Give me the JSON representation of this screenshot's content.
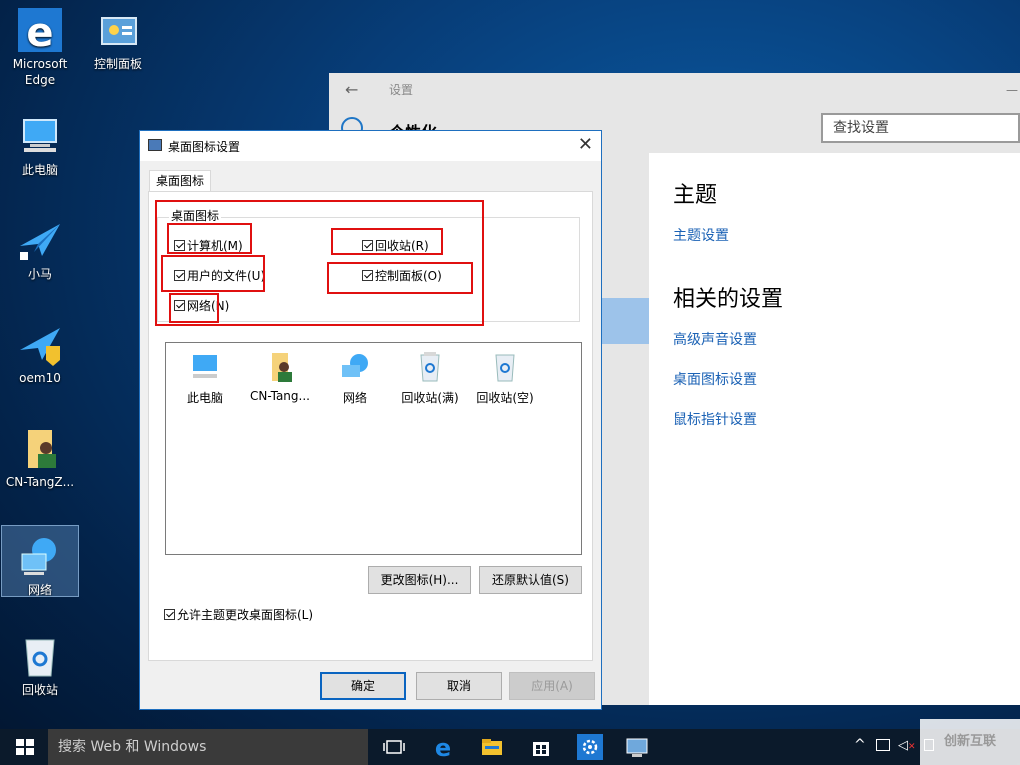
{
  "desktop": {
    "icons": [
      {
        "label": "Microsoft Edge"
      },
      {
        "label": "控制面板"
      },
      {
        "label": "此电脑"
      },
      {
        "label": "小马"
      },
      {
        "label": "oem10"
      },
      {
        "label": "CN-TangZ..."
      },
      {
        "label": "网络"
      },
      {
        "label": "回收站"
      }
    ]
  },
  "settings": {
    "window_title": "设置",
    "page_title": "个性化",
    "search_placeholder": "查找设置",
    "section_theme": "主题",
    "link_theme_settings": "主题设置",
    "section_related": "相关的设置",
    "link_advanced_sound": "高级声音设置",
    "link_desktop_icons": "桌面图标设置",
    "link_mouse_pointer": "鼠标指针设置"
  },
  "dialog": {
    "title": "桌面图标设置",
    "tab": "桌面图标",
    "group_label": "桌面图标",
    "checkboxes": {
      "computer": "计算机(M)",
      "recycle": "回收站(R)",
      "user_files": "用户的文件(U)",
      "control_panel": "控制面板(O)",
      "network": "网络(N)"
    },
    "icon_list": [
      {
        "label": "此电脑"
      },
      {
        "label": "CN-Tang..."
      },
      {
        "label": "网络"
      },
      {
        "label": "回收站(满)"
      },
      {
        "label": "回收站(空)"
      }
    ],
    "change_icon_button": "更改图标(H)...",
    "restore_default_button": "还原默认值(S)",
    "allow_themes_checkbox": "允许主题更改桌面图标(L)",
    "ok_button": "确定",
    "cancel_button": "取消",
    "apply_button": "应用(A)"
  },
  "taskbar": {
    "search_placeholder": "搜索 Web 和 Windows"
  },
  "watermark": "创新互联",
  "colors": {
    "accent": "#1b62b5",
    "highlight_red": "#e01010",
    "taskbar": "#0b1a2b"
  }
}
